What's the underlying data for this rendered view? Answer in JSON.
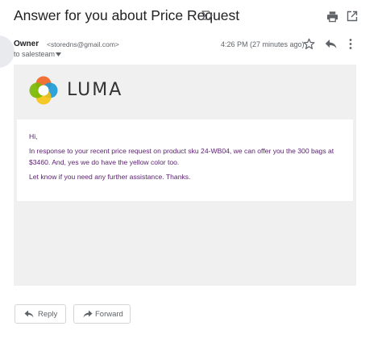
{
  "email": {
    "subject": "Answer for you about Price Request",
    "sender_name": "Owner",
    "sender_email": "<storedns@gmail.com>",
    "recipient": "to salesteam",
    "timestamp": "4:26 PM (27 minutes ago)"
  },
  "content": {
    "brand": "LUMA",
    "greeting": "Hi,",
    "paragraph": "In response to your recent price request on product sku 24-WB04, we can offer you the 300 bags at $3460. And, yes we do have the yellow color too.",
    "closing": "Let know if you need any further assistance. Thanks."
  },
  "actions": {
    "reply_label": "Reply",
    "forward_label": "Forward"
  },
  "icons": {
    "subject": [
      "label-icon",
      "print-icon",
      "popout-icon"
    ],
    "header": [
      "chevron-down-icon",
      "star-icon",
      "reply-icon",
      "more-vert-icon"
    ],
    "buttons": [
      "reply-arrow-icon",
      "forward-arrow-icon"
    ]
  },
  "colors": {
    "message_text": "#5b2170",
    "body_background": "#f0f0f0",
    "logo_orange": "#f26322",
    "logo_green": "#7ab800",
    "logo_yellow": "#f5c311",
    "logo_blue": "#1a9ad6"
  }
}
